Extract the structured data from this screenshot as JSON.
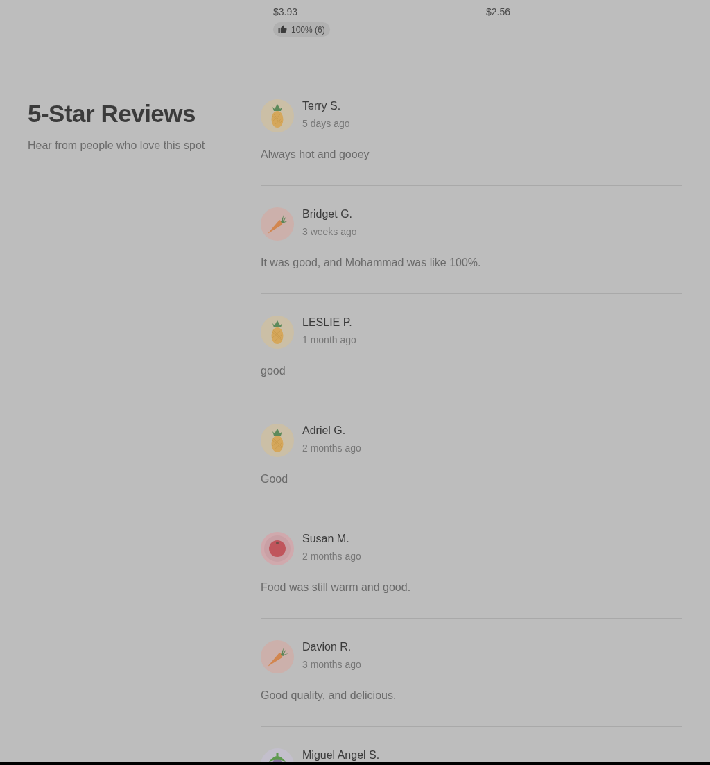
{
  "products": [
    {
      "price": "$3.93",
      "rating": "100% (6)"
    },
    {
      "price": "$2.56"
    }
  ],
  "reviews_section": {
    "title": "5-Star Reviews",
    "subtitle": "Hear from people who love this spot"
  },
  "reviews": [
    {
      "kind": "pineapple",
      "name": "Terry S.",
      "time": "5 days ago",
      "text": "Always hot and gooey"
    },
    {
      "kind": "carrot",
      "name": "Bridget G.",
      "time": "3 weeks ago",
      "text": "It was good, and Mohammad was like 100%."
    },
    {
      "kind": "pineapple",
      "name": "LESLIE P.",
      "time": "1 month ago",
      "text": "good"
    },
    {
      "kind": "pineapple",
      "name": "Adriel G.",
      "time": "2 months ago",
      "text": "Good"
    },
    {
      "kind": "tomato",
      "name": "Susan M.",
      "time": "2 months ago",
      "text": "Food was still warm and good."
    },
    {
      "kind": "carrot",
      "name": "Davion R.",
      "time": "3 months ago",
      "text": "Good quality, and delicious."
    },
    {
      "kind": "eggplant",
      "name": "Miguel Angel S."
    }
  ]
}
